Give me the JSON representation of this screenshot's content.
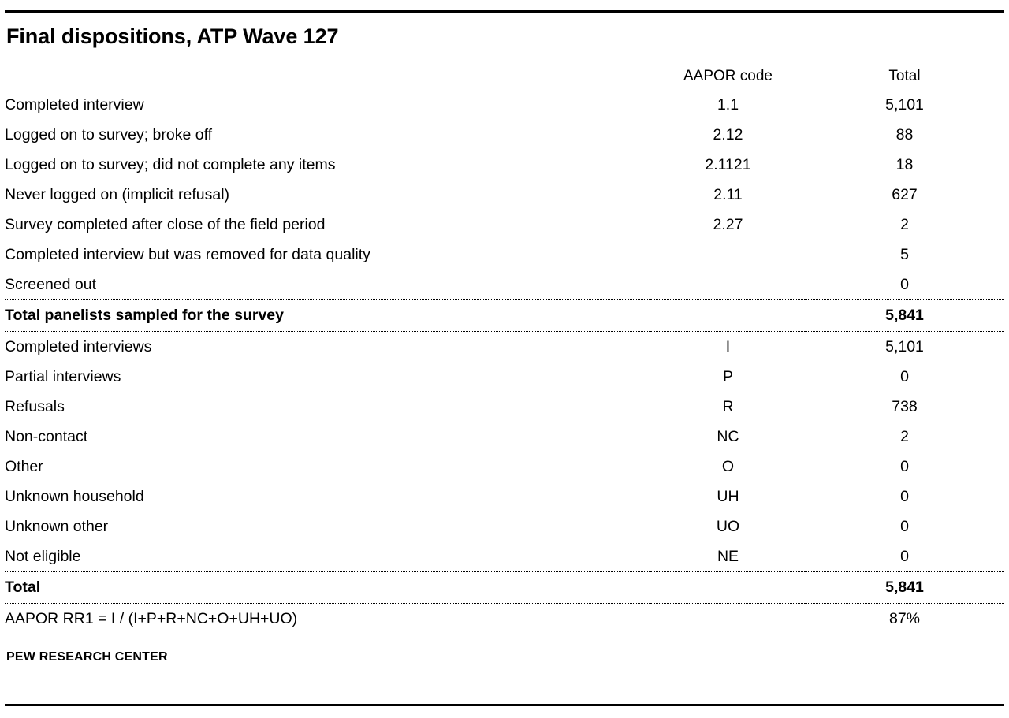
{
  "title": "Final dispositions, ATP Wave 127",
  "headers": {
    "label": "",
    "code": "AAPOR code",
    "total": "Total"
  },
  "rows": [
    {
      "label": "Completed interview",
      "code": "1.1",
      "total": "5,101"
    },
    {
      "label": "Logged on to survey; broke off",
      "code": "2.12",
      "total": "88"
    },
    {
      "label": "Logged on to survey; did not complete any items",
      "code": "2.1121",
      "total": "18"
    },
    {
      "label": "Never logged on (implicit refusal)",
      "code": "2.11",
      "total": "627"
    },
    {
      "label": "Survey completed after close of the field period",
      "code": "2.27",
      "total": "2"
    },
    {
      "label": "Completed interview but was removed for data quality",
      "code": "",
      "total": "5"
    },
    {
      "label": "Screened out",
      "code": "",
      "total": "0"
    }
  ],
  "subtotal": {
    "label": "Total panelists sampled for the survey",
    "code": "",
    "total": "5,841"
  },
  "rows2": [
    {
      "label": "Completed interviews",
      "code": "I",
      "total": "5,101"
    },
    {
      "label": "Partial interviews",
      "code": "P",
      "total": "0"
    },
    {
      "label": "Refusals",
      "code": "R",
      "total": "738"
    },
    {
      "label": "Non-contact",
      "code": "NC",
      "total": "2"
    },
    {
      "label": "Other",
      "code": "O",
      "total": "0"
    },
    {
      "label": "Unknown household",
      "code": "UH",
      "total": "0"
    },
    {
      "label": "Unknown other",
      "code": "UO",
      "total": "0"
    },
    {
      "label": "Not eligible",
      "code": "NE",
      "total": "0"
    }
  ],
  "total": {
    "label": "Total",
    "code": "",
    "total": "5,841"
  },
  "formula": {
    "label": "AAPOR RR1 = I / (I+P+R+NC+O+UH+UO)",
    "code": "",
    "total": "87%"
  },
  "footer": "PEW RESEARCH CENTER"
}
